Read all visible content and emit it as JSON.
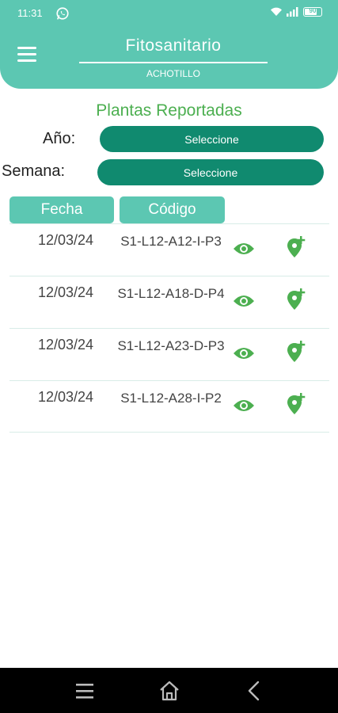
{
  "status_bar": {
    "time": "11:31",
    "battery": "90"
  },
  "header": {
    "title": "Fitosanitario",
    "subtitle": "ACHOTILLO"
  },
  "section_title": "Plantas Reportadas",
  "filters": {
    "year": {
      "label": "Año:",
      "value": "Seleccione"
    },
    "week": {
      "label": "Semana:",
      "value": "Seleccione"
    }
  },
  "table": {
    "columns": [
      "Fecha",
      "Código"
    ],
    "rows": [
      {
        "date": "12/03/24",
        "code": "S1-L12-A12-I-P3"
      },
      {
        "date": "12/03/24",
        "code": "S1-L12-A18-D-P4"
      },
      {
        "date": "12/03/24",
        "code": "S1-L12-A23-D-P3"
      },
      {
        "date": "12/03/24",
        "code": "S1-L12-A28-I-P2"
      }
    ]
  },
  "icons": {
    "menu": "hamburger-icon",
    "view": "eye-icon",
    "add_location": "add-location-icon",
    "nav": [
      "recent-apps-icon",
      "home-icon",
      "back-icon"
    ]
  },
  "colors": {
    "primary": "#5cc7b2",
    "dark": "#108a6f",
    "accent_green": "#4caf50"
  }
}
